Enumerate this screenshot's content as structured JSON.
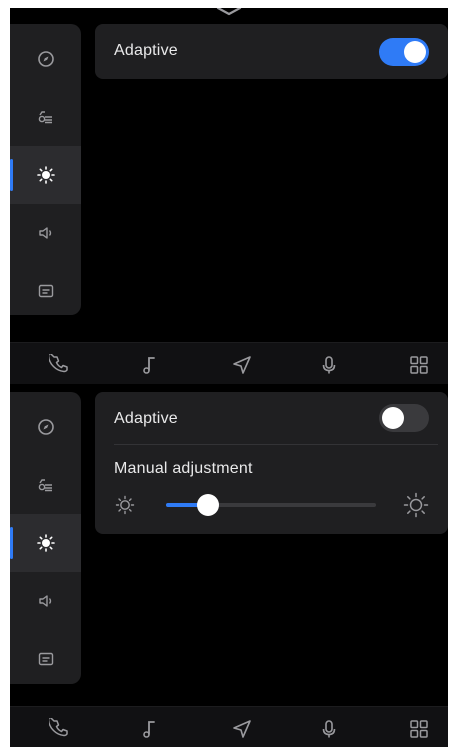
{
  "theme": {
    "accent": "#2f7bf6",
    "background": "#000000",
    "panel": "#1f1f21",
    "text": "#e9e9ea",
    "icon": "#9a9a9e"
  },
  "sidebar": {
    "items": [
      {
        "icon": "compass-icon"
      },
      {
        "icon": "car-icon"
      },
      {
        "icon": "brightness-icon",
        "active": true
      },
      {
        "icon": "volume-icon"
      },
      {
        "icon": "display-icon"
      }
    ]
  },
  "bottom_nav": {
    "items": [
      {
        "icon": "phone-icon"
      },
      {
        "icon": "music-icon"
      },
      {
        "icon": "navigation-icon"
      },
      {
        "icon": "microphone-icon"
      },
      {
        "icon": "apps-grid-icon"
      }
    ]
  },
  "top_state": {
    "adaptive_label": "Adaptive",
    "adaptive_on": true
  },
  "bottom_state": {
    "adaptive_label": "Adaptive",
    "adaptive_on": false,
    "manual_label": "Manual adjustment",
    "brightness_level": 0.2,
    "min_icon": "sun-outline-small-icon",
    "max_icon": "sun-outline-large-icon"
  }
}
